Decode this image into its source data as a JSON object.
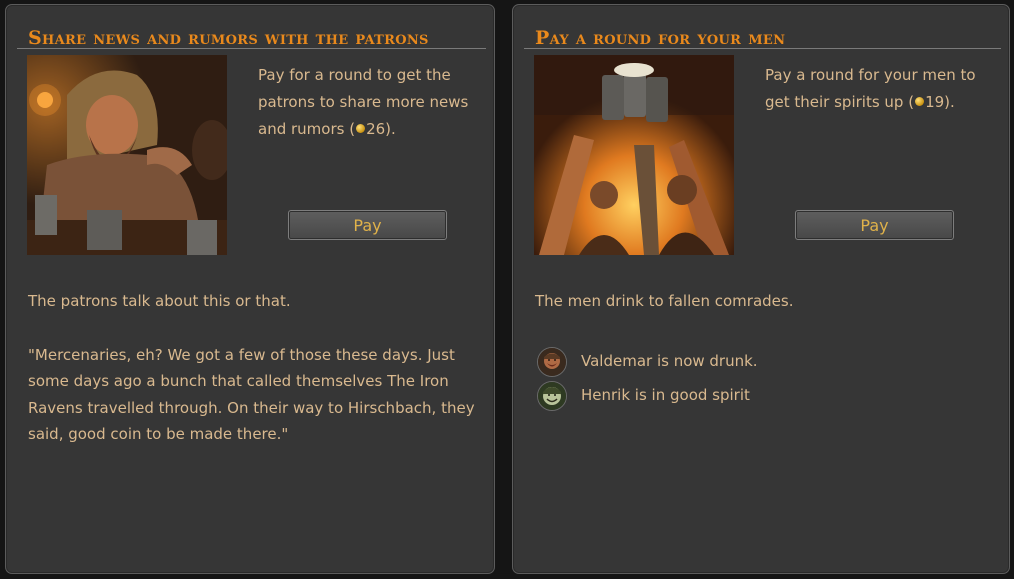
{
  "left_panel": {
    "title": "Share news and rumors with the patrons",
    "desc_before": "Pay for a round to get the patrons to share more news and rumors (",
    "cost": "26",
    "desc_after": ").",
    "pay_label": "Pay",
    "result": "The patrons talk about this or that.",
    "quote": "\"Mercenaries, eh? We got a few of those these days. Just some days ago a bunch that called themselves The Iron Ravens travelled through. On their way to Hirschbach, they said, good coin to be made there.\""
  },
  "right_panel": {
    "title": "Pay a round for your men",
    "desc_before": "Pay a round for your men to get their spirits up (",
    "cost": "19",
    "desc_after": ").",
    "pay_label": "Pay",
    "result": "The men drink to fallen comrades.",
    "effects": [
      {
        "text": "Valdemar is now drunk.",
        "icon": "drunk-portrait-icon"
      },
      {
        "text": "Henrik is in good spirit",
        "icon": "happy-portrait-icon"
      }
    ]
  },
  "colors": {
    "title": "#e9891c",
    "text": "#d9b98f",
    "button_text": "#e0b24a",
    "panel_bg": "#363636"
  }
}
